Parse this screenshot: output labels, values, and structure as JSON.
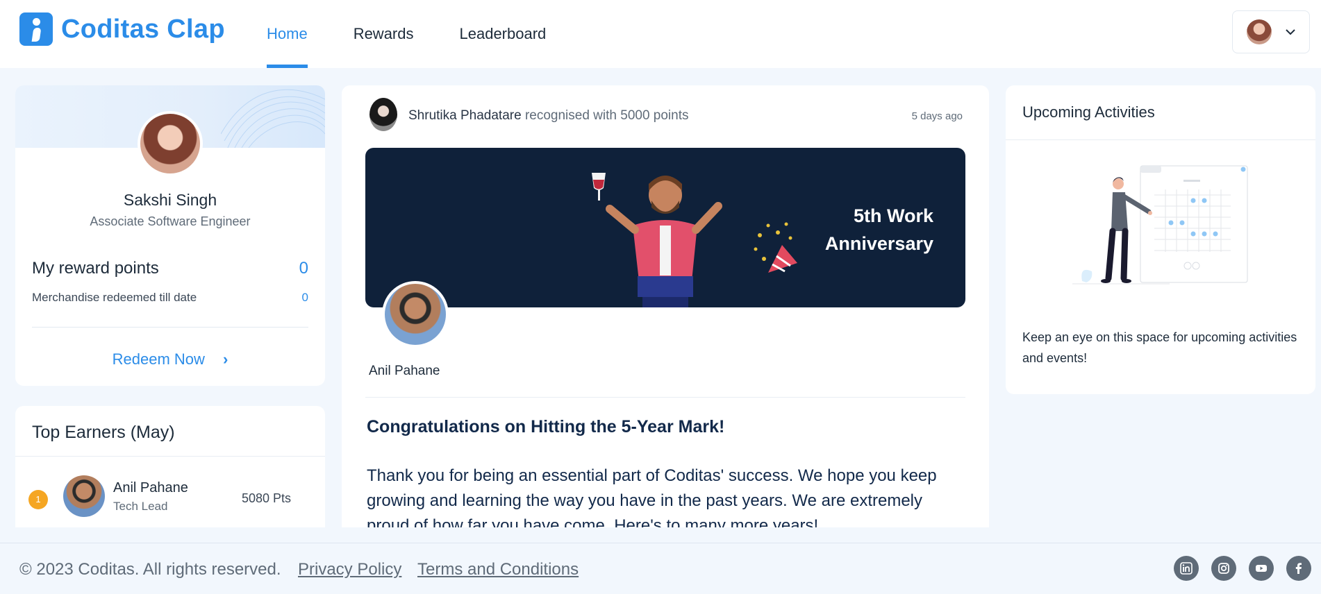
{
  "app": {
    "name": "Coditas Clap",
    "brand_color": "#2b8ce8"
  },
  "nav": {
    "items": [
      "Home",
      "Rewards",
      "Leaderboard"
    ],
    "active": "Home"
  },
  "profile": {
    "name": "Sakshi Singh",
    "role": "Associate Software Engineer",
    "reward_points_label": "My reward points",
    "reward_points": "0",
    "merch_label": "Merchandise redeemed till date",
    "merch_value": "0",
    "redeem_label": "Redeem Now"
  },
  "top_earners": {
    "title": "Top Earners (May)",
    "items": [
      {
        "rank": "1",
        "name": "Anil Pahane",
        "role": "Tech Lead",
        "points": "5080 Pts"
      }
    ]
  },
  "feed": {
    "author": "Shrutika Phadatare",
    "action": "recognised with 5000 points",
    "time": "5 days ago",
    "banner_line1": "5th Work",
    "banner_line2": "Anniversary",
    "recipient": "Anil Pahane",
    "heading": "Congratulations on Hitting the 5-Year Mark!",
    "body": "Thank you for being an essential part of Coditas' success. We hope you keep growing and learning the way you have in the past years. We are extremely proud of how far you have come. Here's to many more years!"
  },
  "activities": {
    "title": "Upcoming Activities",
    "text": "Keep an eye on this space for upcoming activities and events!"
  },
  "footer": {
    "copyright": "© 2023 Coditas. All rights reserved.",
    "privacy": "Privacy Policy",
    "terms": "Terms and Conditions",
    "social_icons": [
      "linkedin-icon",
      "instagram-icon",
      "youtube-icon",
      "facebook-icon"
    ]
  }
}
